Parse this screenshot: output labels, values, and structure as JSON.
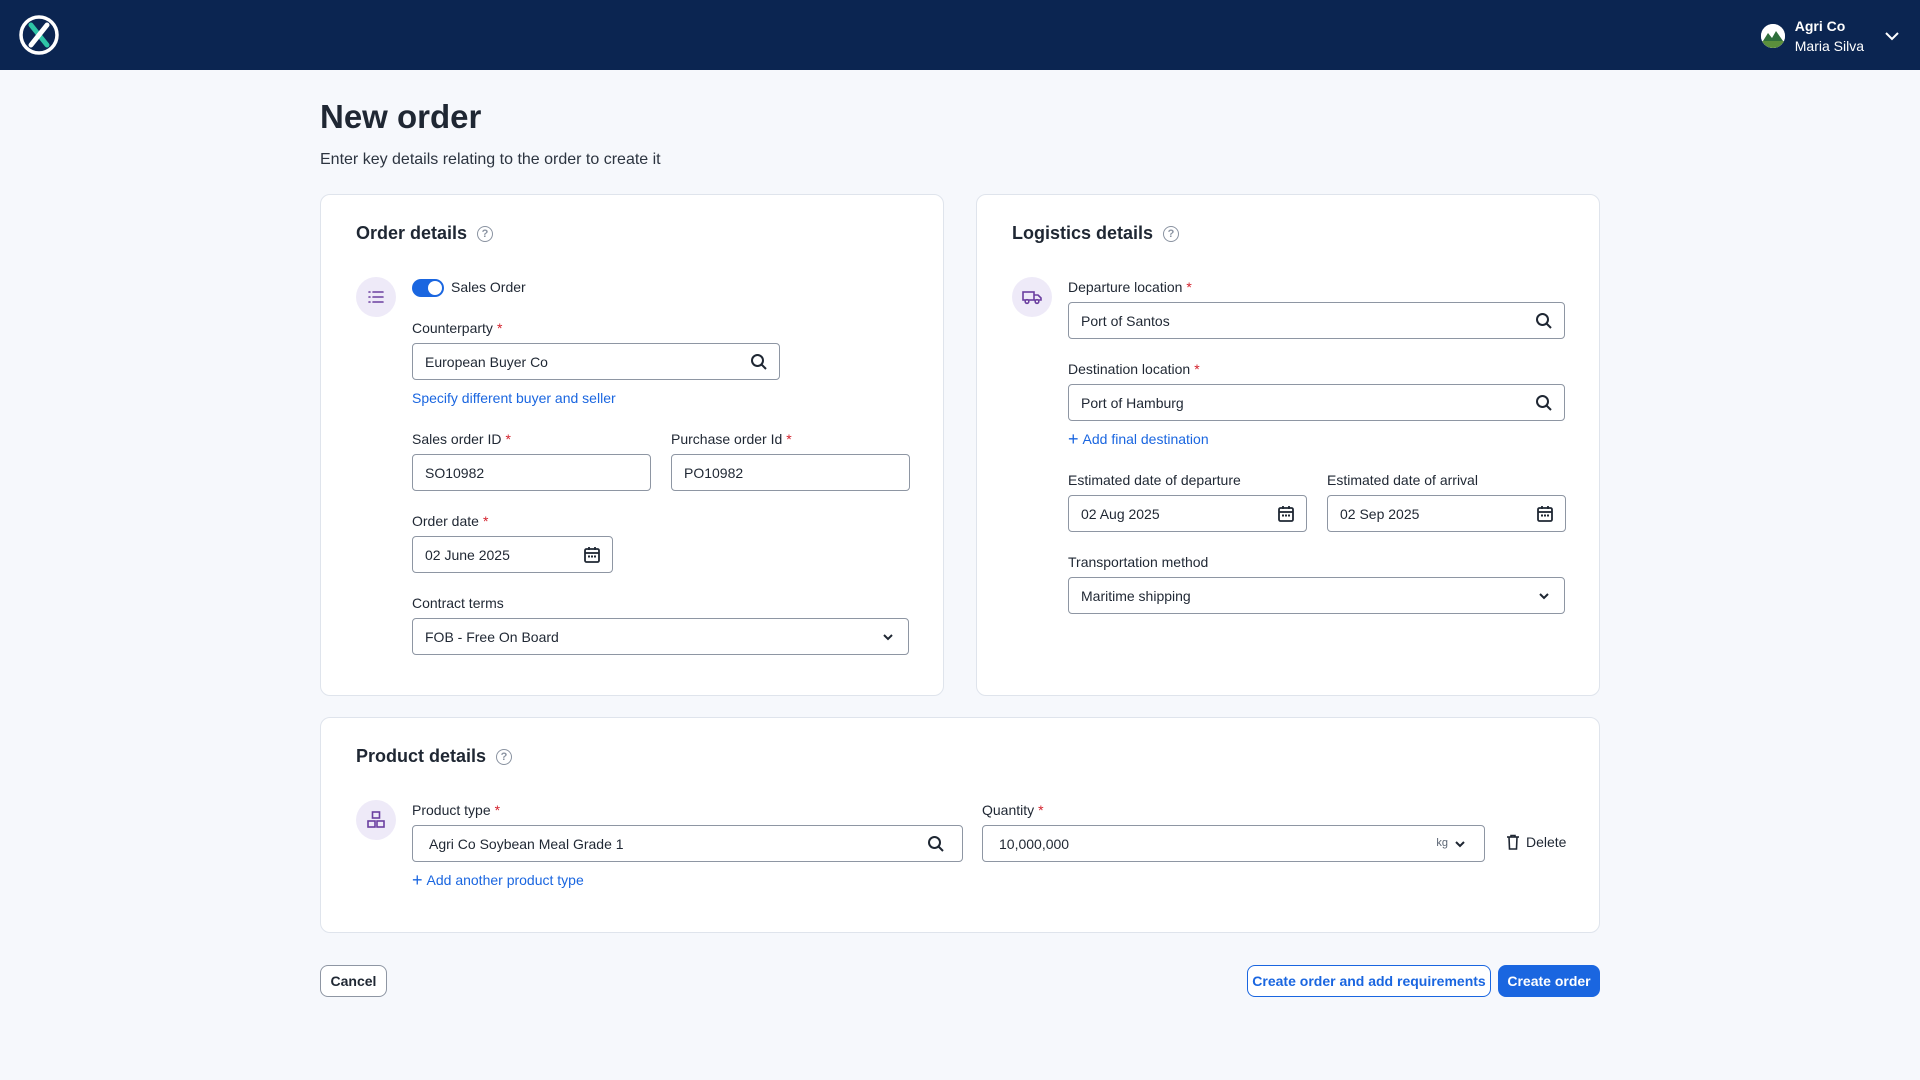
{
  "user": {
    "company": "Agri Co",
    "name": "Maria Silva"
  },
  "page": {
    "title": "New order",
    "subtitle": "Enter key details relating to the order to create it"
  },
  "order_details": {
    "title": "Order details",
    "toggle_label": "Sales Order",
    "toggle_on": true,
    "counterparty": {
      "label": "Counterparty",
      "value": "European Buyer Co"
    },
    "specify_link": "Specify different buyer and seller",
    "sales_order_id": {
      "label": "Sales order ID",
      "value": "SO10982"
    },
    "purchase_order_id": {
      "label": "Purchase order Id",
      "value": "PO10982"
    },
    "order_date": {
      "label": "Order date",
      "value": "02 June 2025"
    },
    "contract_terms": {
      "label": "Contract terms",
      "value": "FOB - Free On Board"
    }
  },
  "logistics_details": {
    "title": "Logistics details",
    "departure": {
      "label": "Departure location",
      "value": "Port of Santos"
    },
    "destination": {
      "label": "Destination location",
      "value": "Port of Hamburg"
    },
    "add_final_destination": "Add final destination",
    "est_departure": {
      "label": "Estimated date of departure",
      "value": "02 Aug 2025"
    },
    "est_arrival": {
      "label": "Estimated date of arrival",
      "value": "02 Sep 2025"
    },
    "transport": {
      "label": "Transportation method",
      "value": "Maritime shipping"
    }
  },
  "product_details": {
    "title": "Product details",
    "product_type": {
      "label": "Product type",
      "value": "Agri Co Soybean Meal Grade 1"
    },
    "quantity": {
      "label": "Quantity",
      "value": "10,000,000",
      "unit": "kg"
    },
    "delete_label": "Delete",
    "add_product": "Add another product type"
  },
  "actions": {
    "cancel": "Cancel",
    "create_and_add": "Create order and add requirements",
    "create": "Create order"
  },
  "colors": {
    "header": "#0b2551",
    "primary": "#1a66e0",
    "required": "#d3212c",
    "icon_bg": "#eeeaf8",
    "icon_fg": "#6b3fa0"
  }
}
